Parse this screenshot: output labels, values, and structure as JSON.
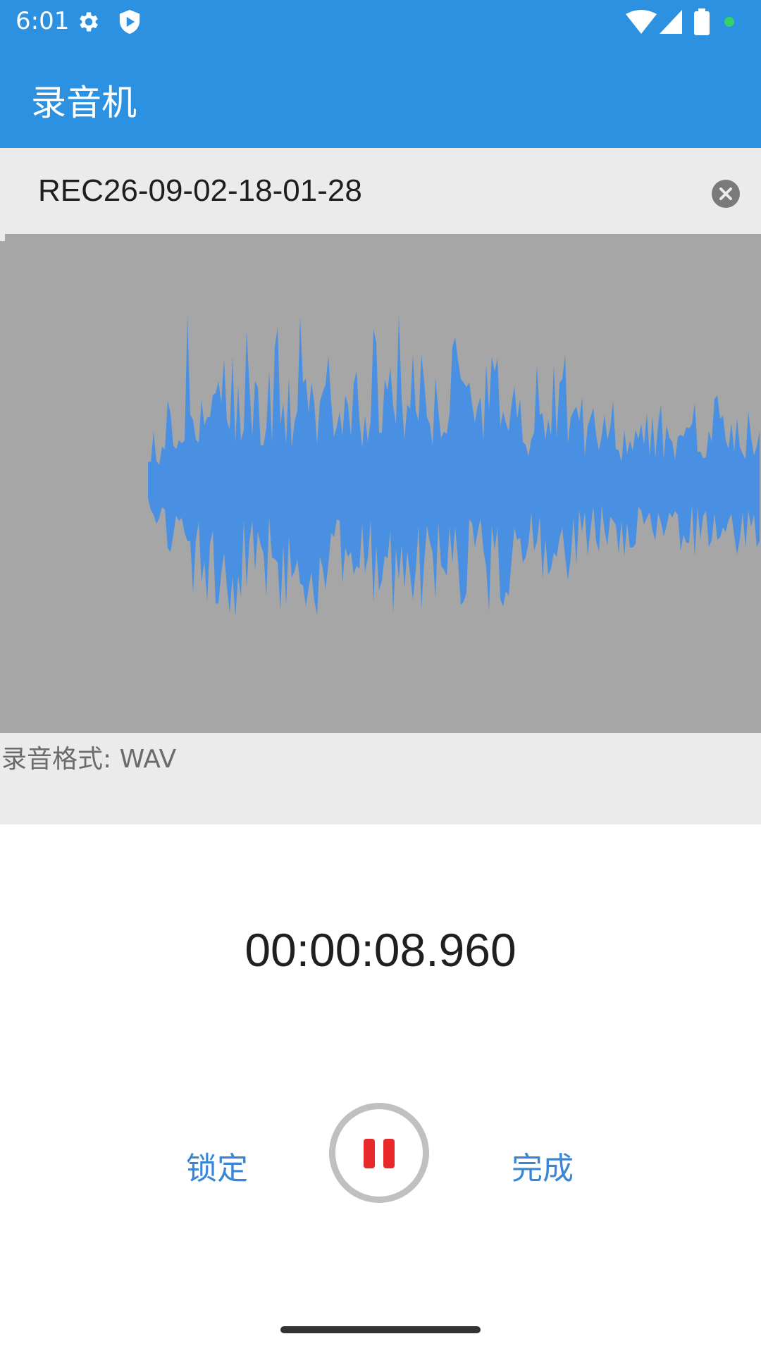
{
  "status_bar": {
    "time": "6:01",
    "icons": [
      "gear-icon",
      "shield-icon",
      "wifi-icon",
      "signal-icon",
      "battery-icon",
      "notification-dot"
    ],
    "dot_color": "#34d36a"
  },
  "app_bar": {
    "title": "录音机",
    "color": "#2c91e0"
  },
  "recording": {
    "file_name": "REC26-09-02-18-01-28",
    "clear_icon": "close-circle-icon",
    "format_label": "录音格式: WAV",
    "elapsed": "00:00:08.960",
    "waveform_color": "#4a90e2",
    "waveform_background": "#a6a6a6"
  },
  "controls": {
    "lock_label": "锁定",
    "done_label": "完成",
    "record_icon": "pause-icon",
    "accent": "#3a86d6",
    "record_color": "#e8292b"
  }
}
